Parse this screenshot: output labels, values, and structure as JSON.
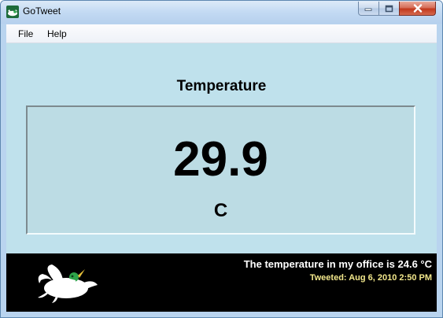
{
  "window": {
    "title": "GoTweet",
    "app_icon": "gotweet-bird-icon"
  },
  "title_buttons": {
    "minimize_icon": "minimize-icon",
    "maximize_icon": "maximize-icon",
    "close_icon": "close-icon"
  },
  "menu": {
    "items": [
      {
        "label": "File"
      },
      {
        "label": "Help"
      }
    ]
  },
  "reading": {
    "heading": "Temperature",
    "value": "29.9",
    "unit": "C"
  },
  "tweet": {
    "text": "The temperature in my office is 24.6 °C",
    "timestamp": "Tweeted: Aug 6, 2010 2:50 PM",
    "logo": "white-bird-logo"
  },
  "colors": {
    "client_background": "#bfe1ec",
    "panel_background": "#bcdce4",
    "tweet_bar_background": "#000000",
    "tweet_text": "#ffffff",
    "tweet_timestamp": "#f3e88c",
    "close_button": "#c2381c"
  }
}
